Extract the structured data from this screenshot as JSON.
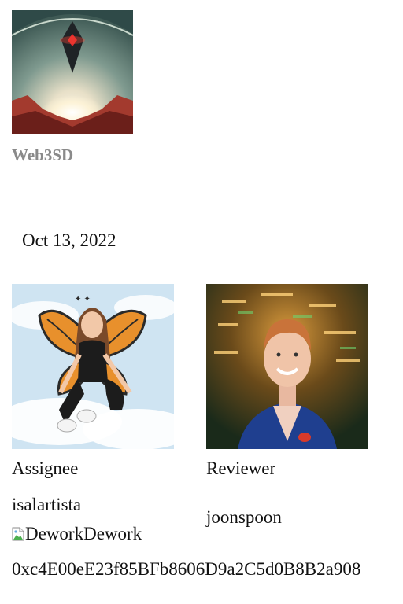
{
  "org": {
    "name": "Web3SD",
    "logo_icon": "no-mans-sky-diamond-logo"
  },
  "task": {
    "date": "Oct 13, 2022"
  },
  "assignee": {
    "role_label": "Assignee",
    "username": "isalartista",
    "avatar_icon": "butterfly-wings-illustration-avatar",
    "linked_org_alt": "Dework",
    "linked_org_name": "Dework",
    "wallet_address": "0xc4E00eE23f85BFb8606D9a2C5d0B8B2a908"
  },
  "reviewer": {
    "role_label": "Reviewer",
    "username": "joonspoon",
    "avatar_icon": "photo-portrait-avatar"
  },
  "colors": {
    "org_name": "#8a8a8a",
    "text": "#111111",
    "background": "#ffffff"
  }
}
